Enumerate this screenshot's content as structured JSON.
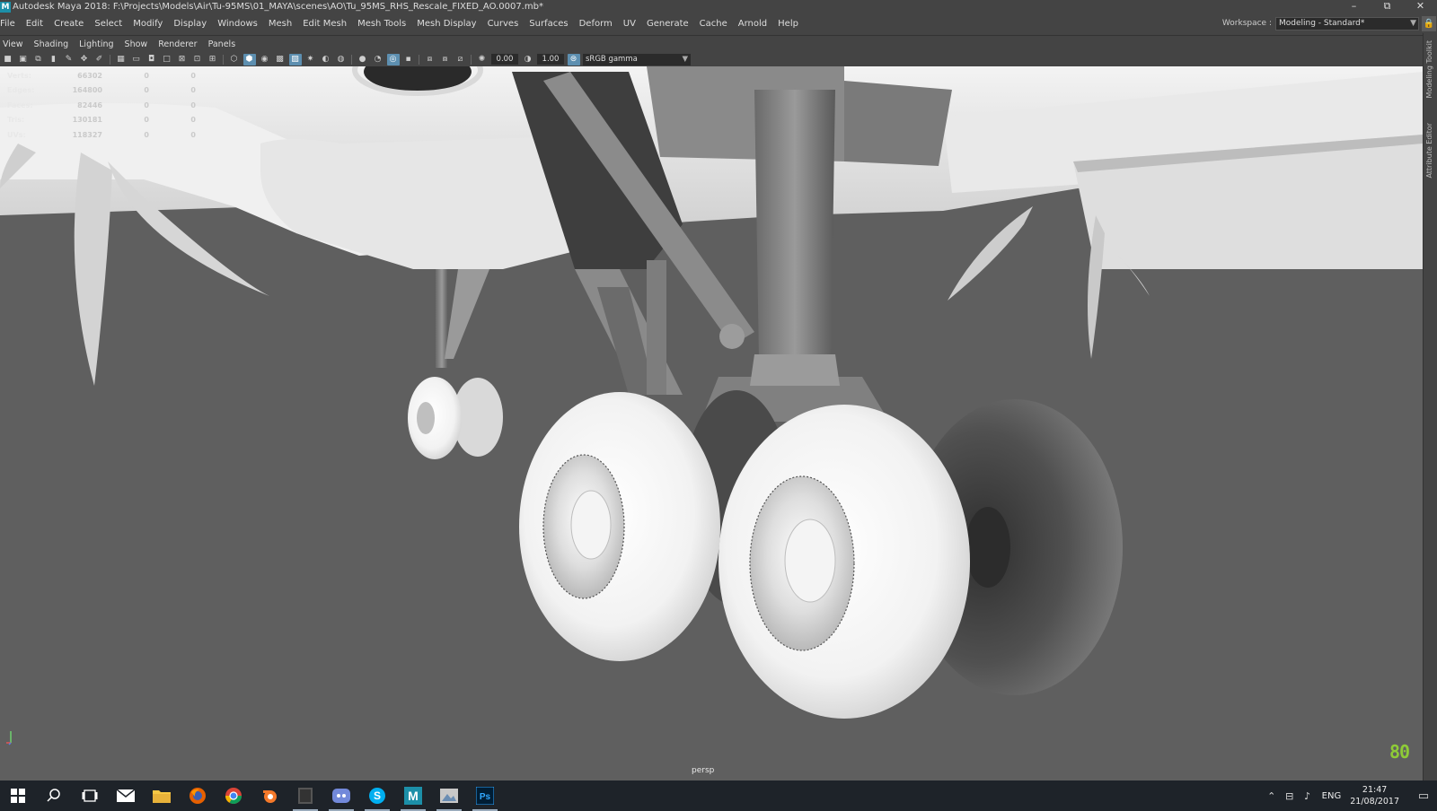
{
  "window": {
    "logo": "M",
    "title": "Autodesk Maya 2018: F:\\Projects\\Models\\Air\\Tu-95MS\\01_MAYA\\scenes\\AO\\Tu_95MS_RHS_Rescale_FIXED_AO.0007.mb*",
    "minimize_glyph": "–",
    "restore_glyph": "⧉",
    "close_glyph": "✕"
  },
  "menubar": {
    "items": [
      "File",
      "Edit",
      "Create",
      "Select",
      "Modify",
      "Display",
      "Windows",
      "Mesh",
      "Edit Mesh",
      "Mesh Tools",
      "Mesh Display",
      "Curves",
      "Surfaces",
      "Deform",
      "UV",
      "Generate",
      "Cache",
      "Arnold",
      "Help"
    ],
    "workspace_label": "Workspace :",
    "workspace_value": "Modeling - Standard*",
    "lock_glyph": "🔒"
  },
  "panel_menu": {
    "items": [
      "View",
      "Shading",
      "Lighting",
      "Show",
      "Renderer",
      "Panels"
    ]
  },
  "panel_toolbar": {
    "exposure": "0.00",
    "gamma": "1.00",
    "color_space": "sRGB gamma"
  },
  "hud": {
    "rows": [
      {
        "label": "Verts:",
        "value": "66302",
        "a": "0",
        "b": "0"
      },
      {
        "label": "Edges:",
        "value": "164800",
        "a": "0",
        "b": "0"
      },
      {
        "label": "Faces:",
        "value": "82446",
        "a": "0",
        "b": "0"
      },
      {
        "label": "Tris:",
        "value": "130181",
        "a": "0",
        "b": "0"
      },
      {
        "label": "UVs:",
        "value": "118327",
        "a": "0",
        "b": "0"
      }
    ]
  },
  "viewport": {
    "camera": "persp",
    "logo_text": "80",
    "background_color": "#5f5f5f"
  },
  "side_tabs": [
    "Modeling Toolkit",
    "Attribute Editor"
  ],
  "taskbar": {
    "apps": [
      {
        "icon": "start-icon",
        "open": false
      },
      {
        "icon": "search-icon",
        "open": false
      },
      {
        "icon": "task-view-icon",
        "open": false
      },
      {
        "icon": "mail-icon",
        "open": false
      },
      {
        "icon": "file-explorer-icon",
        "open": false
      },
      {
        "icon": "firefox-icon",
        "open": false
      },
      {
        "icon": "chrome-icon",
        "open": false
      },
      {
        "icon": "orange-app-icon",
        "open": false
      },
      {
        "icon": "dark-app-icon",
        "open": true
      },
      {
        "icon": "discord-icon",
        "open": true
      },
      {
        "icon": "skype-icon",
        "open": true
      },
      {
        "icon": "maya-icon",
        "open": true
      },
      {
        "icon": "image-viewer-icon",
        "open": true
      },
      {
        "icon": "photoshop-icon",
        "open": true
      }
    ],
    "language": "ENG",
    "time": "21:47",
    "date": "21/08/2017"
  },
  "colors": {
    "ui_bg": "#444444",
    "viewport_bg": "#5f5f5f",
    "active_icon": "#5d8fb0",
    "logo_green": "#8ecb37",
    "taskbar_bg": "#1e2329"
  }
}
